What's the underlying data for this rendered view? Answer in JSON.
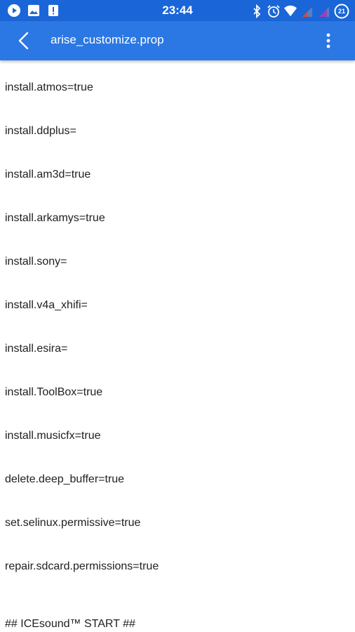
{
  "status_bar": {
    "time": "23:44",
    "battery_level": "21",
    "left_icons": [
      "play-icon",
      "image-icon",
      "alert-icon"
    ],
    "right_icons": [
      "bluetooth-icon",
      "alarm-icon",
      "wifi-icon",
      "signal-icon",
      "signal-icon",
      "battery-icon"
    ]
  },
  "app_bar": {
    "title": "arise_customize.prop",
    "background": "#2b78e4",
    "status_background": "#1a66d9"
  },
  "file_lines": [
    "install.atmos=true",
    "install.ddplus=",
    "install.am3d=true",
    "install.arkamys=true",
    "install.sony=",
    "install.v4a_xhifi=",
    "install.esira=",
    "install.ToolBox=true",
    "install.musicfx=true",
    "delete.deep_buffer=true",
    "set.selinux.permissive=true",
    "repair.sdcard.permissions=true",
    "",
    "## ICEsound™ START ##"
  ]
}
